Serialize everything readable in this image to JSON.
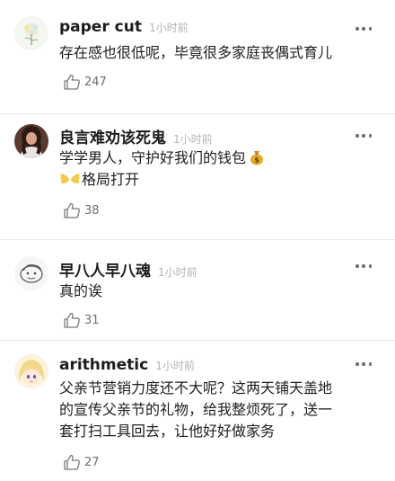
{
  "comments": [
    {
      "author": "paper cut",
      "time": "1小时前",
      "lines": [
        "存在感也很低呢，毕竟很多家庭丧偶式育儿"
      ],
      "likes": "247",
      "avatar_icon": "flower-avatar-icon"
    },
    {
      "author": "良言难劝该死鬼",
      "time": "1小时前",
      "lines": [
        "学学男人，守护好我们的钱包",
        "格局打开"
      ],
      "likes": "38",
      "avatar_icon": "woman-portrait-avatar-icon",
      "emoji_icons": [
        "money-bag-icon",
        "wings-icon"
      ]
    },
    {
      "author": "早八人早八魂",
      "time": "1小时前",
      "lines": [
        "真的诶"
      ],
      "likes": "31",
      "avatar_icon": "cartoon-sketch-avatar-icon"
    },
    {
      "author": "arithmetic",
      "time": "1小时前",
      "lines": [
        "父亲节营销力度还不大呢？这两天铺天盖地",
        "的宣传父亲节的礼物，给我整烦死了，送一",
        "套打扫工具回去，让他好好做家务"
      ],
      "likes": "27",
      "avatar_icon": "anime-girl-avatar-icon"
    }
  ],
  "colors": {
    "name": "#1d1d1d",
    "time": "#b4b4b4",
    "text": "#1e1e1e",
    "like": "#6e6e6e",
    "divider": "#ececec"
  }
}
